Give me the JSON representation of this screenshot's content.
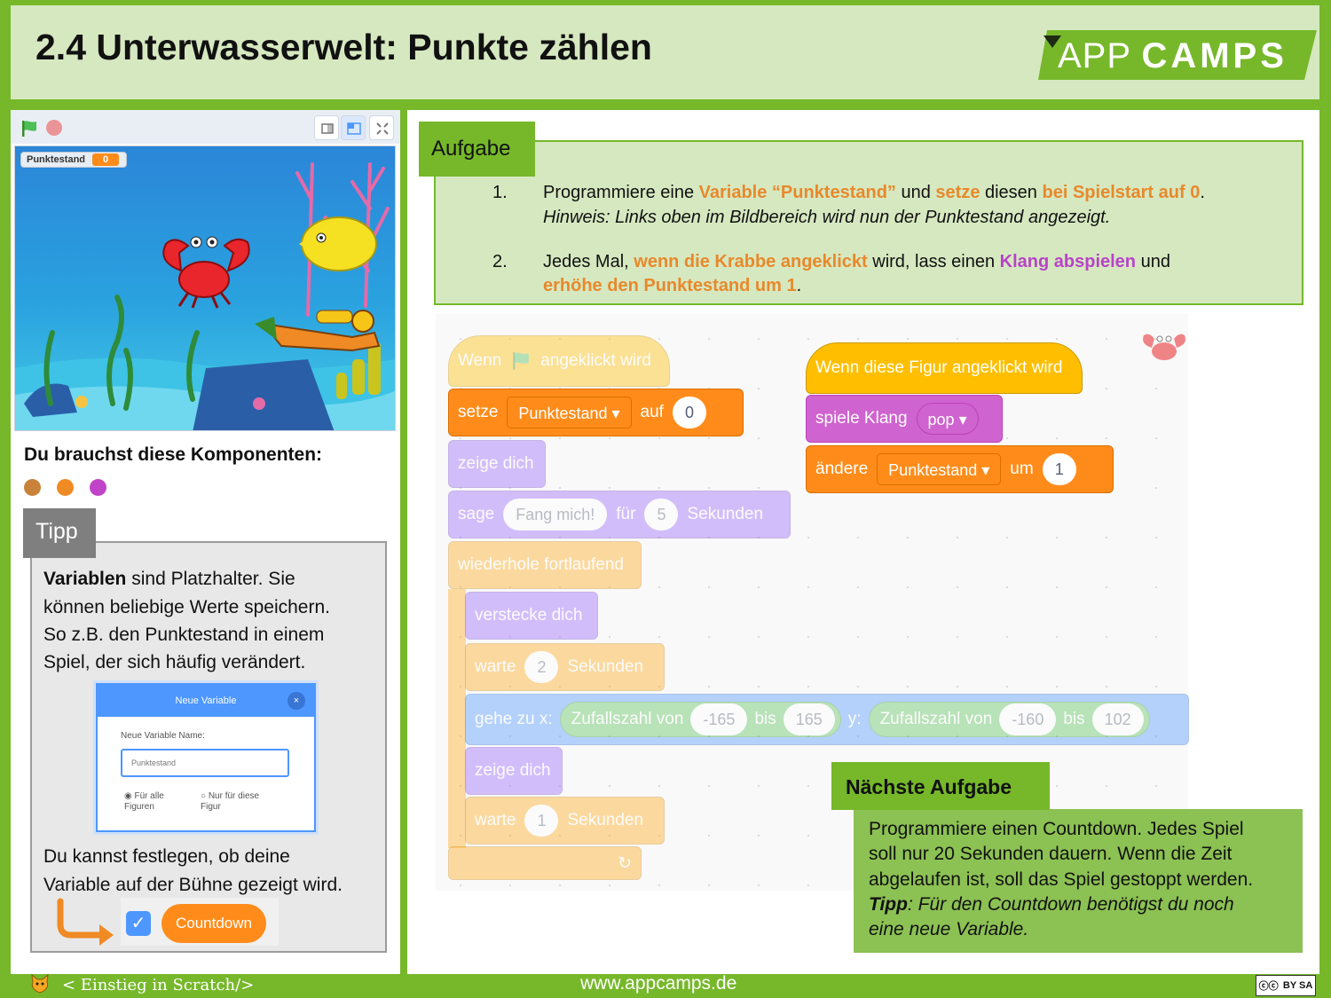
{
  "header": {
    "title": "2.4 Unterwasserwelt: Punkte zählen",
    "logo_light": "APP",
    "logo_bold": "CAMPS"
  },
  "stage": {
    "monitor_name": "Punktestand",
    "monitor_value": "0"
  },
  "components": {
    "heading": "Du brauchst diese Komponenten:",
    "colors": [
      "#c8823a",
      "#f08a24",
      "#c043c8"
    ]
  },
  "tipp": {
    "label": "Tipp",
    "bold_word": "Variablen",
    "line1_rest": " sind Platzhalter. Sie",
    "line2": "können beliebige Werte speichern.",
    "line3": "So z.B. den Punktestand in einem",
    "line4": "Spiel, der sich häufig verändert.",
    "line5": "Du kannst festlegen, ob deine",
    "line6": "Variable auf der Bühne gezeigt wird.",
    "countdown_chip": "Countdown"
  },
  "dialog": {
    "title": "Neue Variable",
    "close": "×",
    "name_label": "Neue Variable Name:",
    "input_value": "Punktestand",
    "radio_all_1": "Für alle",
    "radio_all_2": "Figuren",
    "radio_this_1": "Nur für diese",
    "radio_this_2": "Figur"
  },
  "aufgabe": {
    "label": "Aufgabe",
    "num1": "1.",
    "t1_a": "Programmiere eine ",
    "t1_b": "Variable “Punktestand”",
    "t1_c": " und ",
    "t1_d": "setze",
    "t1_e": " diesen ",
    "t1_f": "bei Spielstart auf 0",
    "t1_g": ".",
    "t1_hint": "Hinweis: Links oben im Bildbereich wird nun der Punktestand angezeigt.",
    "num2": "2.",
    "t2_a": "Jedes Mal, ",
    "t2_b": "wenn die Krabbe angeklickt",
    "t2_c": " wird, lass einen ",
    "t2_d": "Klang abspielen",
    "t2_e": " und",
    "t2_f": "erhöhe den Punktestand um 1",
    "t2_g": "."
  },
  "blocks": {
    "when_flag_a": "Wenn",
    "when_flag_b": "angeklickt wird",
    "set": "setze",
    "set_var": "Punktestand",
    "set_to": "auf",
    "set_val": "0",
    "show1": "zeige dich",
    "say": "sage",
    "say_text": "Fang mich!",
    "say_for": "für",
    "say_secs": "5",
    "say_unit": "Sekunden",
    "forever": "wiederhole fortlaufend",
    "hide": "verstecke dich",
    "wait1": "warte",
    "wait1_val": "2",
    "wait1_unit": "Sekunden",
    "goto": "gehe zu x:",
    "rand1": "Zufallszahl von",
    "rand1_a": "-165",
    "rand1_bis": "bis",
    "rand1_b": "165",
    "goto_y": "y:",
    "rand2": "Zufallszahl von",
    "rand2_a": "-160",
    "rand2_bis": "bis",
    "rand2_b": "102",
    "show2": "zeige dich",
    "wait2": "warte",
    "wait2_val": "1",
    "wait2_unit": "Sekunden",
    "when_clicked": "Wenn diese Figur angeklickt wird",
    "play": "spiele Klang",
    "play_sound": "pop",
    "change": "ändere",
    "change_var": "Punktestand",
    "change_by": "um",
    "change_val": "1"
  },
  "naechste": {
    "label": "Nächste Aufgabe",
    "l1": "Programmiere einen Countdown. Jedes Spiel",
    "l2": "soll nur 20 Sekunden dauern. Wenn die Zeit",
    "l3": "abgelaufen ist, soll das Spiel gestoppt werden.",
    "l4_bold": "Tipp",
    "l4_rest": ": Für den Countdown benötigst du noch",
    "l5": "eine neue Variable."
  },
  "footer": {
    "left": "< Einstieg in Scratch/>",
    "url": "www.appcamps.de",
    "license": "BY SA"
  }
}
